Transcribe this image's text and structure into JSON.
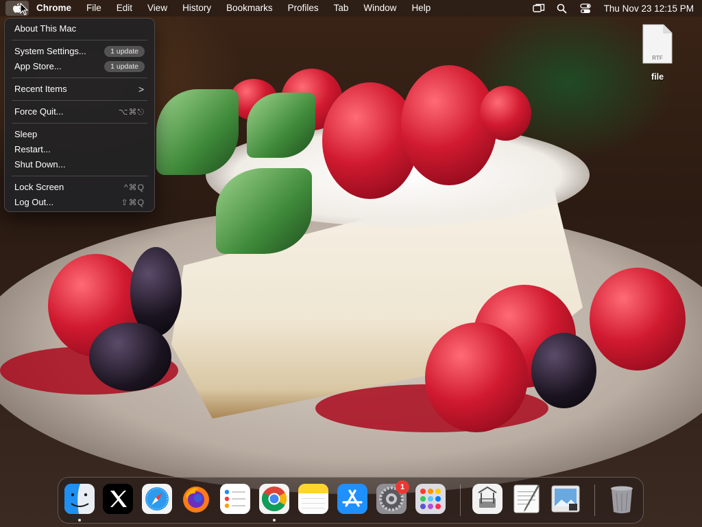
{
  "menubar": {
    "app_name": "Chrome",
    "items": [
      "File",
      "Edit",
      "View",
      "History",
      "Bookmarks",
      "Profiles",
      "Tab",
      "Window",
      "Help"
    ],
    "clock": "Thu Nov 23  12:15 PM",
    "status_icons": [
      "screen-mirroring-icon",
      "spotlight-search-icon",
      "control-center-icon"
    ]
  },
  "apple_menu": {
    "about": "About This Mac",
    "system_settings": "System Settings...",
    "system_settings_badge": "1 update",
    "app_store": "App Store...",
    "app_store_badge": "1 update",
    "recent_items": "Recent Items",
    "recent_items_arrow": ">",
    "force_quit": "Force Quit...",
    "force_quit_shortcut": "⌥⌘⎋",
    "sleep": "Sleep",
    "restart": "Restart...",
    "shut_down": "Shut Down...",
    "lock_screen": "Lock Screen",
    "lock_screen_shortcut": "^⌘Q",
    "log_out": "Log Out...",
    "log_out_shortcut": "⇧⌘Q"
  },
  "desktop": {
    "file_name": "file",
    "file_type_label": "RTF"
  },
  "dock": {
    "apps": [
      "Finder",
      "X",
      "Safari",
      "Firefox",
      "Reminders",
      "Google Chrome",
      "Notes",
      "App Store",
      "System Settings",
      "Launchpad",
      "Archive Utility",
      "TextEdit",
      "Preview",
      "Trash"
    ],
    "system_settings_badge": "1"
  },
  "colors": {
    "menu_background": "#222224",
    "badge_red": "#e83a34"
  }
}
